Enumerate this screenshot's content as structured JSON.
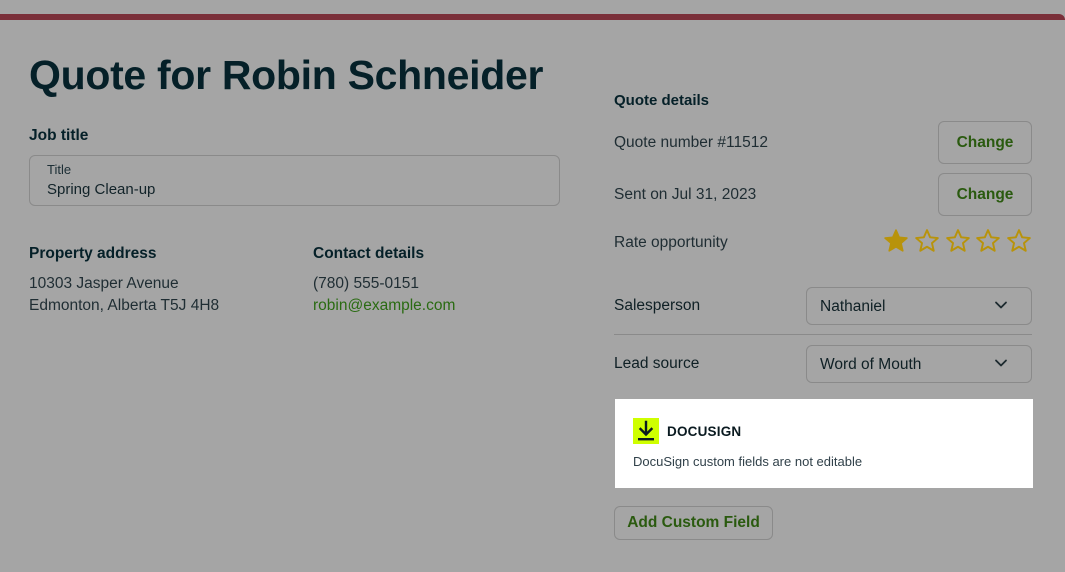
{
  "page": {
    "title": "Quote for Robin Schneider"
  },
  "job": {
    "heading": "Job title",
    "field_label": "Title",
    "value": "Spring Clean-up"
  },
  "property": {
    "heading": "Property address",
    "line1": "10303 Jasper Avenue",
    "line2": "Edmonton, Alberta T5J 4H8"
  },
  "contact": {
    "heading": "Contact details",
    "phone": "(780) 555-0151",
    "email": "robin@example.com"
  },
  "quote_details": {
    "heading": "Quote details",
    "number_text": "Quote number #11512",
    "sent_text": "Sent on Jul 31, 2023",
    "change_label": "Change",
    "rate_label": "Rate opportunity",
    "rating": 1,
    "rating_max": 5
  },
  "salesperson": {
    "label": "Salesperson",
    "value": "Nathaniel"
  },
  "lead_source": {
    "label": "Lead source",
    "value": "Word of Mouth"
  },
  "docusign": {
    "title": "DOCUSIGN",
    "note": "DocuSign custom fields are not editable",
    "icon": "download-icon"
  },
  "actions": {
    "add_custom_field": "Add Custom Field"
  },
  "colors": {
    "accent_bar": "#7a2f39",
    "star_filled": "#b8930b",
    "link": "#2a6b12",
    "docusign_yellow": "#cfff00"
  }
}
